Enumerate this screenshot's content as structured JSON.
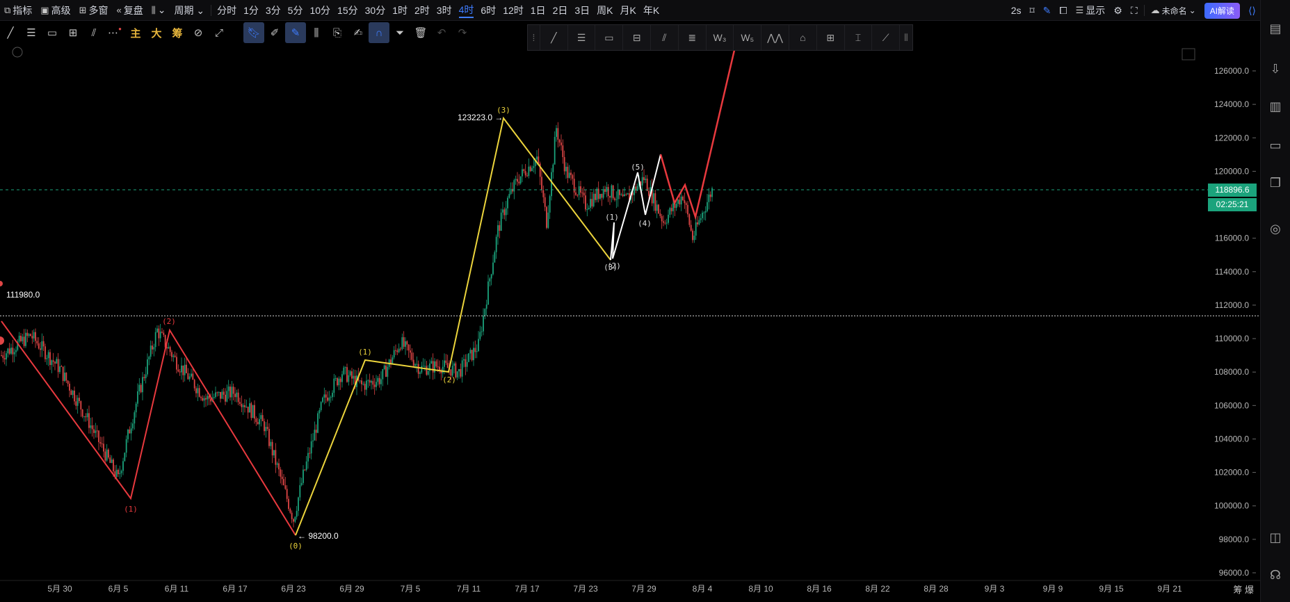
{
  "topbar": {
    "items": [
      {
        "icon": "chart-indicator-icon",
        "glyph": "⧉",
        "label": "指标"
      },
      {
        "icon": "advanced-icon",
        "glyph": "▣",
        "label": "高级"
      },
      {
        "icon": "multi-window-icon",
        "glyph": "⊞",
        "label": "多窗"
      },
      {
        "icon": "replay-icon",
        "glyph": "«",
        "label": "复盘"
      },
      {
        "icon": "candle-type-icon",
        "glyph": "⫼",
        "label": "⌄"
      },
      {
        "icon": "period-icon",
        "glyph": "",
        "label": "周期 ⌄"
      }
    ],
    "periods": [
      "分时",
      "1分",
      "3分",
      "5分",
      "10分",
      "15分",
      "30分",
      "1时",
      "2时",
      "3时",
      "4时",
      "6时",
      "12时",
      "1日",
      "2日",
      "3日",
      "周K",
      "月K",
      "年K"
    ],
    "active_period": "4时",
    "right": {
      "refresh": "2s",
      "display": "显示",
      "layout_name": "未命名",
      "ai_label": "AI解读"
    }
  },
  "drawbar": {
    "cn_buttons": [
      "主",
      "大",
      "筹"
    ]
  },
  "price_axis": {
    "ticks": [
      "126000.0",
      "124000.0",
      "122000.0",
      "120000.0",
      "118000.0",
      "116000.0",
      "114000.0",
      "112000.0",
      "110000.0",
      "108000.0",
      "106000.0",
      "104000.0",
      "102000.0",
      "100000.0",
      "98000.0",
      "96000.0"
    ],
    "current_price": "118896.6",
    "countdown": "02:25:21",
    "current_color": "#1ba37c"
  },
  "time_axis": {
    "ticks": [
      "5月 30",
      "6月 5",
      "6月 11",
      "6月 17",
      "6月 23",
      "6月 29",
      "7月 5",
      "7月 11",
      "7月 17",
      "7月 23",
      "7月 29",
      "8月 4",
      "8月 10",
      "8月 16",
      "8月 22",
      "8月 28",
      "9月 3",
      "9月 9",
      "9月 15",
      "9月 21"
    ],
    "corner_label": "筹 爆"
  },
  "annotations": {
    "high_label": "123223.0 →",
    "low_label": "← 98200.0",
    "hline_label": "111980.0",
    "red_waves": [
      "(1)",
      "(2)"
    ],
    "yellow_waves": [
      "(0)",
      "(1)",
      "(2)",
      "(3)"
    ],
    "white_waves": [
      "(1)",
      "(3)",
      "(4)",
      "(5)",
      "(2)"
    ]
  },
  "colors": {
    "up": "#1ba37c",
    "down": "#e04646",
    "red_wave": "#e8393e",
    "yellow_wave": "#ecd43c",
    "white_wave": "#ffffff",
    "accent": "#3f7dff"
  }
}
